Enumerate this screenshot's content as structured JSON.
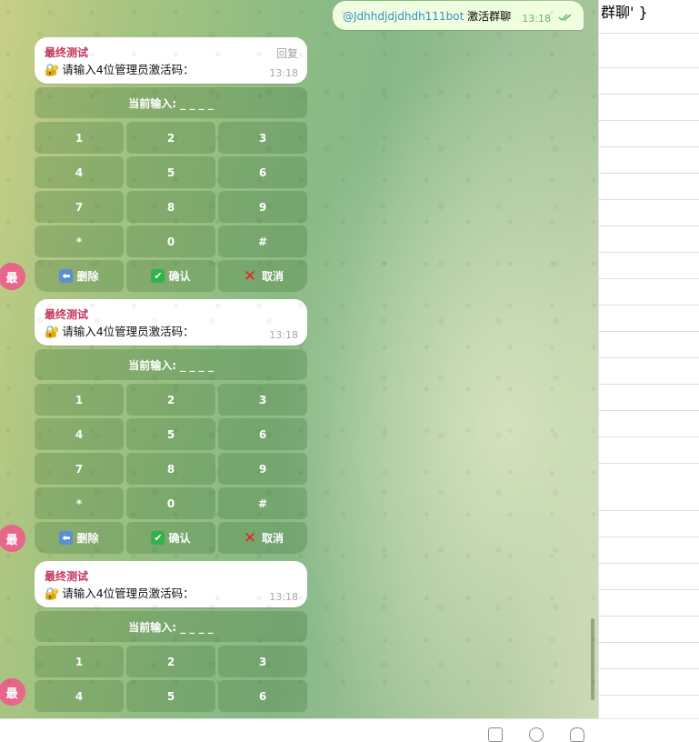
{
  "outgoing": {
    "mention": "@Jdhhdjdjdhdh111bot",
    "text": "激活群聊",
    "time": "13:18"
  },
  "messages": [
    {
      "sender": "最终测试",
      "body": "请输入4位管理员激活码：",
      "reply": "回复",
      "time": "13:18",
      "avatar": "最",
      "current_input": "当前输入: _ _ _ _",
      "keys": [
        [
          "1",
          "2",
          "3"
        ],
        [
          "4",
          "5",
          "6"
        ],
        [
          "7",
          "8",
          "9"
        ],
        [
          "*",
          "0",
          "#"
        ]
      ],
      "actions": [
        "删除",
        "确认",
        "取消"
      ]
    },
    {
      "sender": "最终测试",
      "body": "请输入4位管理员激活码：",
      "time": "13:18",
      "avatar": "最",
      "current_input": "当前输入: _ _ _ _",
      "keys": [
        [
          "1",
          "2",
          "3"
        ],
        [
          "4",
          "5",
          "6"
        ],
        [
          "7",
          "8",
          "9"
        ],
        [
          "*",
          "0",
          "#"
        ]
      ],
      "actions": [
        "删除",
        "确认",
        "取消"
      ]
    },
    {
      "sender": "最终测试",
      "body": "请输入4位管理员激活码：",
      "time": "13:18",
      "avatar": "最",
      "current_input": "当前输入: _ _ _ _",
      "keys": [
        [
          "1",
          "2",
          "3"
        ],
        [
          "4",
          "5",
          "6"
        ]
      ]
    }
  ],
  "side_code": "群聊' }",
  "colors": {
    "sender": "#c2365b",
    "mention": "#3a8fc4",
    "outgoing_bg": "#eefedf",
    "avatar": "#e8668a"
  }
}
